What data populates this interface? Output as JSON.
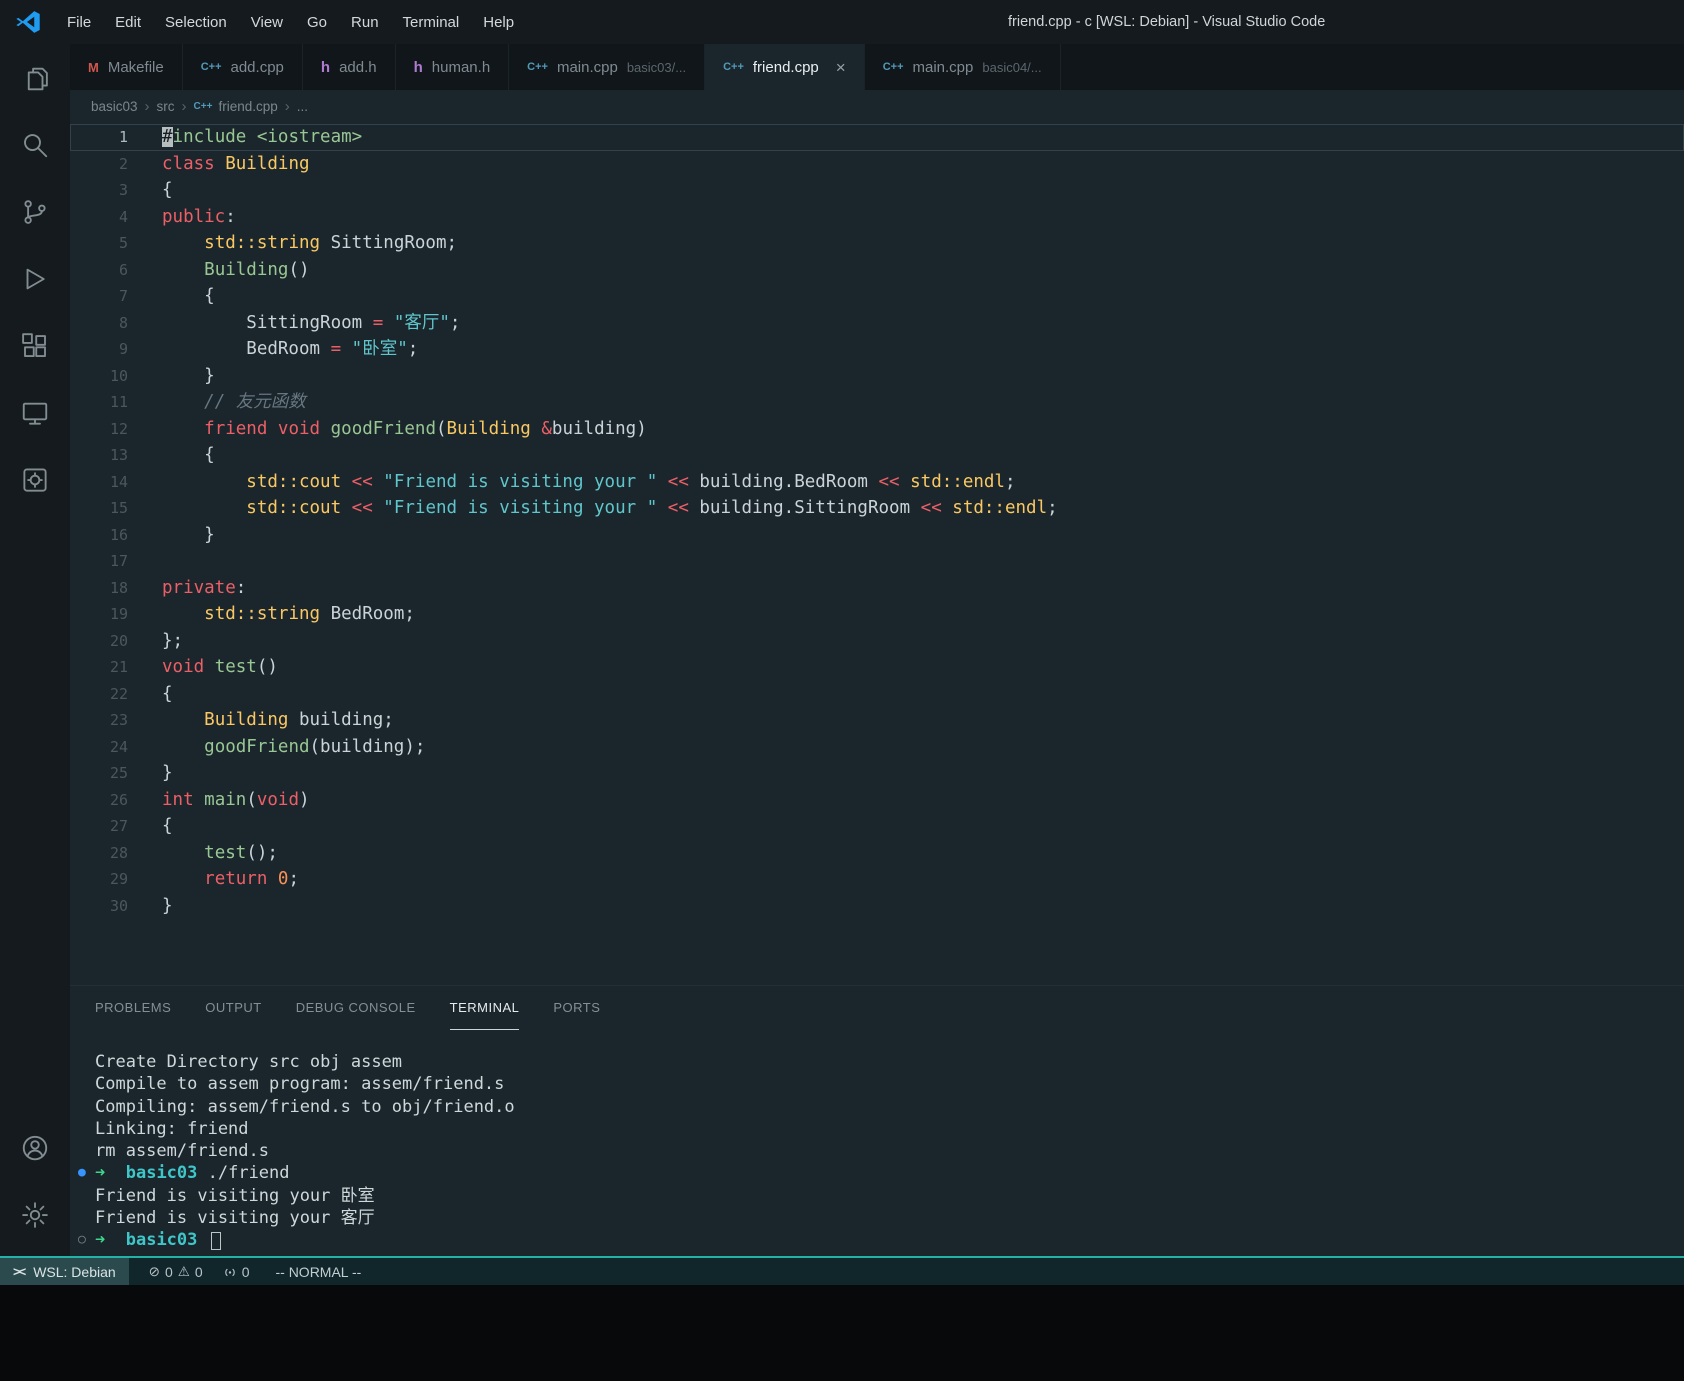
{
  "title_bar": {
    "menus": [
      "File",
      "Edit",
      "Selection",
      "View",
      "Go",
      "Run",
      "Terminal",
      "Help"
    ],
    "title": "friend.cpp - c [WSL: Debian] - Visual Studio Code"
  },
  "activity_bar": {
    "top": [
      "explorer",
      "search",
      "source-control",
      "run-debug",
      "extensions",
      "remote-explorer",
      "custom-editors"
    ],
    "bottom": [
      "accounts",
      "settings"
    ]
  },
  "file_icons": {
    "cpp": "C++",
    "h": "h",
    "makefile": "M"
  },
  "editor_tabs": [
    {
      "label": "Makefile",
      "icon": "makefile"
    },
    {
      "label": "add.cpp",
      "icon": "cpp"
    },
    {
      "label": "add.h",
      "icon": "h"
    },
    {
      "label": "human.h",
      "icon": "h"
    },
    {
      "label": "main.cpp",
      "hint": "basic03/...",
      "icon": "cpp"
    },
    {
      "label": "friend.cpp",
      "icon": "cpp",
      "active": true,
      "close_label": "×"
    },
    {
      "label": "main.cpp",
      "hint": "basic04/...",
      "icon": "cpp"
    }
  ],
  "breadcrumb": {
    "items": [
      "basic03",
      "src",
      "friend.cpp",
      "..."
    ],
    "file_index": 2
  },
  "editor": {
    "lines": [
      {
        "n": "1",
        "current": true,
        "segs": [
          [
            "cur",
            "#"
          ],
          [
            "pre",
            "include <iostream>"
          ]
        ]
      },
      {
        "n": "2",
        "segs": [
          [
            "k",
            "class"
          ],
          [
            "p",
            " "
          ],
          [
            "t",
            "Building"
          ]
        ]
      },
      {
        "n": "3",
        "segs": [
          [
            "p",
            "{"
          ]
        ]
      },
      {
        "n": "4",
        "segs": [
          [
            "k",
            "public"
          ],
          [
            "p",
            ":"
          ]
        ]
      },
      {
        "n": "5",
        "segs": [
          [
            "p",
            "    "
          ],
          [
            "t",
            "std::string"
          ],
          [
            "p",
            " SittingRoom;"
          ]
        ]
      },
      {
        "n": "6",
        "segs": [
          [
            "p",
            "    "
          ],
          [
            "f",
            "Building"
          ],
          [
            "p",
            "()"
          ]
        ]
      },
      {
        "n": "7",
        "segs": [
          [
            "p",
            "    {"
          ]
        ]
      },
      {
        "n": "8",
        "segs": [
          [
            "p",
            "        SittingRoom "
          ],
          [
            "k",
            "="
          ],
          [
            "p",
            " "
          ],
          [
            "s",
            "\"客厅\""
          ],
          [
            "p",
            ";"
          ]
        ]
      },
      {
        "n": "9",
        "segs": [
          [
            "p",
            "        BedRoom "
          ],
          [
            "k",
            "="
          ],
          [
            "p",
            " "
          ],
          [
            "s",
            "\"卧室\""
          ],
          [
            "p",
            ";"
          ]
        ]
      },
      {
        "n": "10",
        "segs": [
          [
            "p",
            "    }"
          ]
        ]
      },
      {
        "n": "11",
        "segs": [
          [
            "p",
            "    "
          ],
          [
            "c",
            "// 友元函数"
          ]
        ]
      },
      {
        "n": "12",
        "segs": [
          [
            "p",
            "    "
          ],
          [
            "k",
            "friend"
          ],
          [
            "p",
            " "
          ],
          [
            "k",
            "void"
          ],
          [
            "p",
            " "
          ],
          [
            "f",
            "goodFriend"
          ],
          [
            "p",
            "("
          ],
          [
            "t",
            "Building"
          ],
          [
            "p",
            " "
          ],
          [
            "k",
            "&"
          ],
          [
            "p",
            "building)"
          ]
        ]
      },
      {
        "n": "13",
        "segs": [
          [
            "p",
            "    {"
          ]
        ]
      },
      {
        "n": "14",
        "segs": [
          [
            "p",
            "        "
          ],
          [
            "t",
            "std::cout"
          ],
          [
            "p",
            " "
          ],
          [
            "k",
            "<<"
          ],
          [
            "p",
            " "
          ],
          [
            "s",
            "\"Friend is visiting your \""
          ],
          [
            "p",
            " "
          ],
          [
            "k",
            "<<"
          ],
          [
            "p",
            " building.BedRoom "
          ],
          [
            "k",
            "<<"
          ],
          [
            "p",
            " "
          ],
          [
            "t",
            "std::endl"
          ],
          [
            "p",
            ";"
          ]
        ]
      },
      {
        "n": "15",
        "segs": [
          [
            "p",
            "        "
          ],
          [
            "t",
            "std::cout"
          ],
          [
            "p",
            " "
          ],
          [
            "k",
            "<<"
          ],
          [
            "p",
            " "
          ],
          [
            "s",
            "\"Friend is visiting your \""
          ],
          [
            "p",
            " "
          ],
          [
            "k",
            "<<"
          ],
          [
            "p",
            " building.SittingRoom "
          ],
          [
            "k",
            "<<"
          ],
          [
            "p",
            " "
          ],
          [
            "t",
            "std::endl"
          ],
          [
            "p",
            ";"
          ]
        ]
      },
      {
        "n": "16",
        "segs": [
          [
            "p",
            "    }"
          ]
        ]
      },
      {
        "n": "17",
        "segs": []
      },
      {
        "n": "18",
        "segs": [
          [
            "k",
            "private"
          ],
          [
            "p",
            ":"
          ]
        ]
      },
      {
        "n": "19",
        "segs": [
          [
            "p",
            "    "
          ],
          [
            "t",
            "std::string"
          ],
          [
            "p",
            " BedRoom;"
          ]
        ]
      },
      {
        "n": "20",
        "segs": [
          [
            "p",
            "};"
          ]
        ]
      },
      {
        "n": "21",
        "segs": [
          [
            "k",
            "void"
          ],
          [
            "p",
            " "
          ],
          [
            "f",
            "test"
          ],
          [
            "p",
            "()"
          ]
        ]
      },
      {
        "n": "22",
        "segs": [
          [
            "p",
            "{"
          ]
        ]
      },
      {
        "n": "23",
        "segs": [
          [
            "p",
            "    "
          ],
          [
            "t",
            "Building"
          ],
          [
            "p",
            " building;"
          ]
        ]
      },
      {
        "n": "24",
        "segs": [
          [
            "p",
            "    "
          ],
          [
            "f",
            "goodFriend"
          ],
          [
            "p",
            "(building);"
          ]
        ]
      },
      {
        "n": "25",
        "segs": [
          [
            "p",
            "}"
          ]
        ]
      },
      {
        "n": "26",
        "segs": [
          [
            "k",
            "int"
          ],
          [
            "p",
            " "
          ],
          [
            "f",
            "main"
          ],
          [
            "p",
            "("
          ],
          [
            "k",
            "void"
          ],
          [
            "p",
            ")"
          ]
        ]
      },
      {
        "n": "27",
        "segs": [
          [
            "p",
            "{"
          ]
        ]
      },
      {
        "n": "28",
        "segs": [
          [
            "p",
            "    "
          ],
          [
            "f",
            "test"
          ],
          [
            "p",
            "();"
          ]
        ]
      },
      {
        "n": "29",
        "segs": [
          [
            "p",
            "    "
          ],
          [
            "k",
            "return"
          ],
          [
            "p",
            " "
          ],
          [
            "num",
            "0"
          ],
          [
            "p",
            ";"
          ]
        ]
      },
      {
        "n": "30",
        "segs": [
          [
            "p",
            "}"
          ]
        ]
      }
    ]
  },
  "panel": {
    "tabs": [
      "PROBLEMS",
      "OUTPUT",
      "DEBUG CONSOLE",
      "TERMINAL",
      "PORTS"
    ],
    "active_tab": "TERMINAL"
  },
  "terminal": {
    "lines": [
      {
        "segs": [
          [
            "p",
            "Create Directory src obj assem"
          ]
        ]
      },
      {
        "segs": [
          [
            "p",
            "Compile to assem program: assem/friend.s"
          ]
        ]
      },
      {
        "segs": [
          [
            "p",
            "Compiling: assem/friend.s to obj/friend.o"
          ]
        ]
      },
      {
        "segs": [
          [
            "p",
            "Linking: friend"
          ]
        ]
      },
      {
        "segs": [
          [
            "p",
            "rm assem/friend.s"
          ]
        ]
      },
      {
        "dot": "filled",
        "segs": [
          [
            "arrow",
            "➜"
          ],
          [
            "p",
            "  "
          ],
          [
            "dir",
            "basic03"
          ],
          [
            "p",
            " ./friend"
          ]
        ]
      },
      {
        "segs": [
          [
            "p",
            "Friend is visiting your 卧室"
          ]
        ]
      },
      {
        "segs": [
          [
            "p",
            "Friend is visiting your 客厅"
          ]
        ]
      },
      {
        "dot": "open",
        "segs": [
          [
            "arrow",
            "➜"
          ],
          [
            "p",
            "  "
          ],
          [
            "dir",
            "basic03"
          ],
          [
            "p",
            " "
          ],
          [
            "cursor",
            ""
          ]
        ]
      }
    ]
  },
  "status_bar": {
    "remote_icon": "><",
    "remote_label": "WSL: Debian",
    "error_icon": "⊘",
    "error_count": "0",
    "warning_icon": "⚠",
    "warning_count": "0",
    "ports_count": "0",
    "mode": "-- NORMAL --"
  }
}
